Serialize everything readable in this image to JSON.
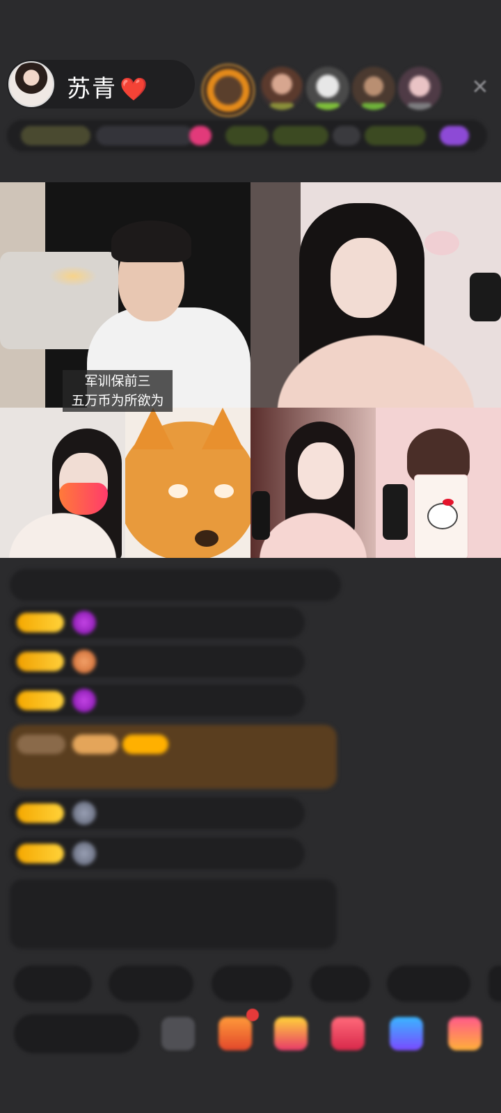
{
  "host": {
    "name": "苏青",
    "heart": "❤️"
  },
  "top_bar": {
    "close_icon": "✕",
    "info_chips": [
      "",
      "",
      "",
      "",
      "",
      "",
      ""
    ]
  },
  "video": {
    "caption_line1": "军训保前三",
    "caption_line2": "五万币为所欲为"
  },
  "chat": {
    "lines": [
      {
        "level": "",
        "user": "",
        "text": ""
      },
      {
        "level": "",
        "user": "",
        "text": ""
      },
      {
        "level": "",
        "user": "",
        "text": ""
      },
      {
        "level": "",
        "user": "",
        "text": ""
      },
      {
        "level": "",
        "user": "",
        "text": ""
      },
      {
        "level": "",
        "user": "",
        "text": ""
      },
      {
        "level": "",
        "user": "",
        "text": ""
      },
      {
        "level": "",
        "user": "",
        "text": ""
      }
    ]
  },
  "bottom": {
    "quick_buttons": [
      "",
      "",
      "",
      "",
      ""
    ],
    "say_placeholder": ""
  },
  "colors": {
    "background": "#2b2b2d",
    "pill": "#1f1f21",
    "level_badge": "#f5a800",
    "heart": "#e4142c",
    "green_text": "#7fd15a",
    "cyan_text": "#3fc3d6",
    "purple_gem": "#a020c8",
    "notice_bg": "#5a3e1f"
  },
  "icons": [
    "avatar-icon",
    "heart-icon",
    "close-icon",
    "gem-icon",
    "gift-icon",
    "more-icon"
  ]
}
